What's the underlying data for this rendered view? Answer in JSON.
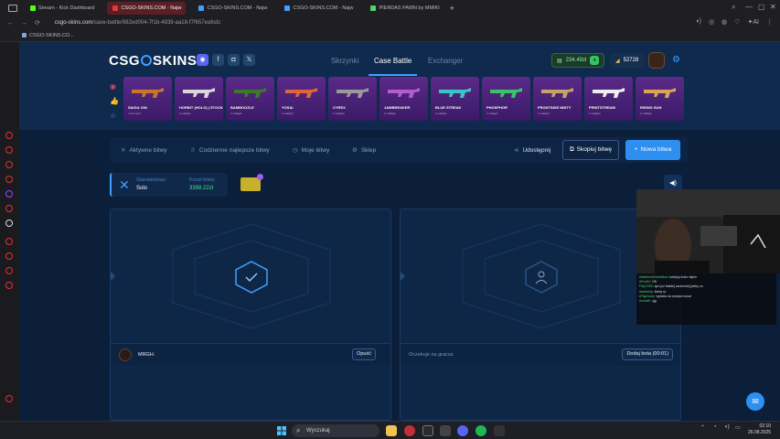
{
  "browser": {
    "tabs": [
      {
        "title": "Stream - Kick Dashboard",
        "color": "#53fc18"
      },
      {
        "title": "CSGO-SKINS.COM - Najw",
        "color": "#e1373d"
      },
      {
        "title": "CSGO-SKINS.COM - Najw",
        "color": "#3fa0ff"
      },
      {
        "title": "CSGO-SKINS.COM - Najw",
        "color": "#3fa0ff"
      },
      {
        "title": "PIERDAS PAWN by MMIKI",
        "color": "#4fd36a"
      }
    ],
    "url_host": "csgo-skins.com",
    "url_path": "/case-battle/982ed004-7f1b-4839-aa18-f7f657eafcdc",
    "bookmark": "CSGO-SKINS.CO..."
  },
  "site": {
    "logo": "CSG SKINS",
    "nav": {
      "cases": "Skrzynki",
      "battle": "Case Battle",
      "exchanger": "Exchanger"
    },
    "balance": "234.49zł",
    "coins": "52728"
  },
  "drops": [
    {
      "name": "SAIGA ONI",
      "sub": "z bez tytuł",
      "bg": "#5b2a8a"
    },
    {
      "name": "HORBIT (HOLO) | STOCKHOLM 2021",
      "sub": "1 naklejki",
      "bg": "#5b2a8a"
    },
    {
      "name": "BAMBOOZLE",
      "sub": "1 naklejki",
      "bg": "#5b2a8a"
    },
    {
      "name": "YOSAI",
      "sub": "1 naklejki",
      "bg": "#5b2a8a"
    },
    {
      "name": "CYREX",
      "sub": "1 naklejki",
      "bg": "#5b2a8a"
    },
    {
      "name": "JAWBREAKER",
      "sub": "1 naklejki",
      "bg": "#5b2a8a"
    },
    {
      "name": "BLUE STREAK",
      "sub": "1 naklejki",
      "bg": "#5b2a8a"
    },
    {
      "name": "PHOSPHOR",
      "sub": "1 naklejki",
      "bg": "#5b2a8a"
    },
    {
      "name": "FRONTSIDE MISTY",
      "sub": "1 naklejki",
      "bg": "#5b2a8a"
    },
    {
      "name": "PRINTSTREAM",
      "sub": "1 naklejki",
      "bg": "#5b2a8a"
    },
    {
      "name": "RISING SUN",
      "sub": "1 naklejki",
      "bg": "#5b2a8a"
    }
  ],
  "battle_tabs": {
    "active": "Aktywne bitwy",
    "daily": "Codzienne najlepsze bitwy",
    "mine": "Moje bitwy",
    "shop": "Sklep",
    "share": "Udostępnij",
    "copy": "Skopiuj bitwę",
    "new": "Nowa bitwa"
  },
  "mode": {
    "type_label": "Standardowy",
    "type_value": "Solo",
    "cost_label": "Koszt bitwy",
    "cost_value": "3398.22zł"
  },
  "players": {
    "p1_name": "MRGH.",
    "p1_button": "Opuść",
    "p2_status": "Oczekuje na gracza",
    "p2_button": "Dodaj bota (00:01)"
  },
  "chat_overlay": [
    {
      "u": "#NiebieskiVambiom:",
      "t": "kolejny kolor fajnie"
    },
    {
      "u": "#Fox64:",
      "t": "OK"
    },
    {
      "u": "Filip7255:",
      "t": "tym już łatwiej wczesniej jakby co"
    },
    {
      "u": "#adrianlp:",
      "t": "kiedy rp"
    },
    {
      "u": "#Tigerowy:",
      "t": "wyslaw na wozipa konal"
    },
    {
      "u": "#czelsK:",
      "t": "gg"
    }
  ],
  "taskbar": {
    "search": "Wyszukaj",
    "time": "02:10",
    "date": "26.08.2025"
  }
}
